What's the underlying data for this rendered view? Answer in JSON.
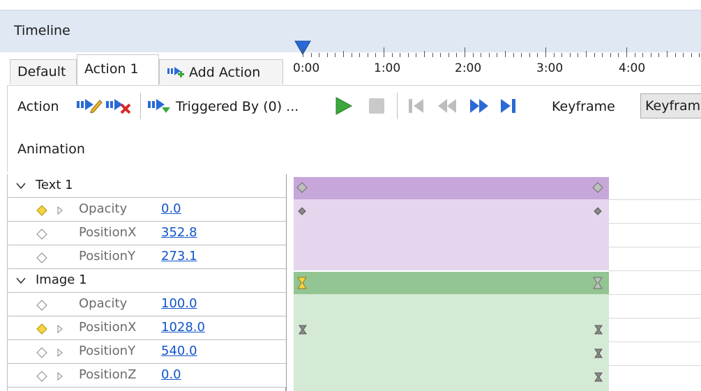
{
  "window": {
    "title": "Timeline"
  },
  "tabs": {
    "default_label": "Default",
    "action1_label": "Action 1",
    "add_label": "Add Action"
  },
  "toolbar": {
    "action_label": "Action",
    "triggered_label": "Triggered By (0) ...",
    "keyframe_label": "Keyframe",
    "keyframe_value": "Keyframe",
    "animation_label": "Animation"
  },
  "ruler": {
    "labels": [
      "0:00",
      "1:00",
      "2:00",
      "3:00",
      "4:00"
    ],
    "playhead": "0:00"
  },
  "tracks": {
    "text1": {
      "name": "Text 1",
      "color": "#c7a6d9",
      "props": [
        {
          "name": "Opacity",
          "value": "0.0"
        },
        {
          "name": "PositionX",
          "value": "352.8"
        },
        {
          "name": "PositionY",
          "value": "273.1"
        }
      ]
    },
    "image1": {
      "name": "Image 1",
      "color": "#93c593",
      "props": [
        {
          "name": "Opacity",
          "value": "100.0"
        },
        {
          "name": "PositionX",
          "value": "1028.0"
        },
        {
          "name": "PositionY",
          "value": "540.0"
        },
        {
          "name": "PositionZ",
          "value": "0.0"
        }
      ]
    }
  },
  "colors": {
    "title_bg": "#dfe8f3",
    "text_group_lane": "#c7a6d9",
    "text_lane": "#e5d6ee",
    "image_group_lane": "#93c593",
    "image_lane": "#d5ead5",
    "play_green": "#3aa83a",
    "accent_blue": "#2a6ad6",
    "link": "#1155cc"
  }
}
